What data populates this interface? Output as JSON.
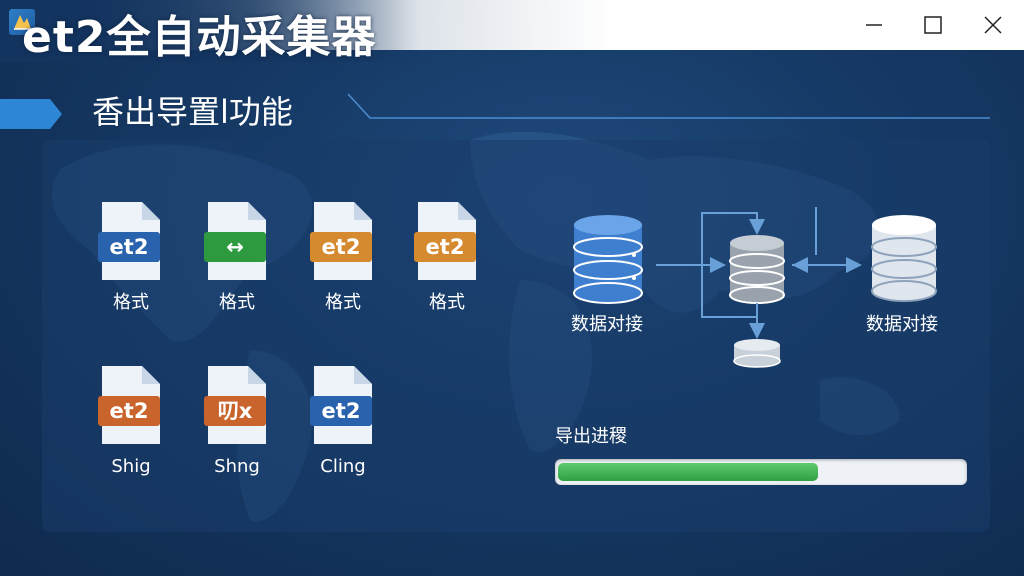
{
  "window": {
    "title": "et2全自动采集器"
  },
  "section": {
    "title": "香出导置l功能"
  },
  "files": [
    {
      "badge": "et2",
      "label": "格式",
      "color": "#2a63ad",
      "icon": "file-et2-icon"
    },
    {
      "badge": "↔",
      "label": "格式",
      "color": "#2d9a3f",
      "icon": "file-convert-icon"
    },
    {
      "badge": "et2",
      "label": "格式",
      "color": "#d68a30",
      "icon": "file-et2-icon"
    },
    {
      "badge": "et2",
      "label": "格式",
      "color": "#d68a30",
      "icon": "file-et2-icon"
    },
    {
      "badge": "et2",
      "label": "Shig",
      "color": "#c9652c",
      "icon": "file-et2-icon"
    },
    {
      "badge": "叨x",
      "label": "Shng",
      "color": "#c9652c",
      "icon": "file-et2-icon"
    },
    {
      "badge": "et2",
      "label": "Cling",
      "color": "#2a63ad",
      "icon": "file-et2-icon"
    }
  ],
  "diagram": {
    "left_label": "数据对接",
    "right_label": "数据对接"
  },
  "progress": {
    "label": "导出进稷",
    "value": 0.64
  },
  "colors": {
    "accent": "#2e86d6",
    "progress": "#3fae52",
    "background": "#163a66"
  }
}
